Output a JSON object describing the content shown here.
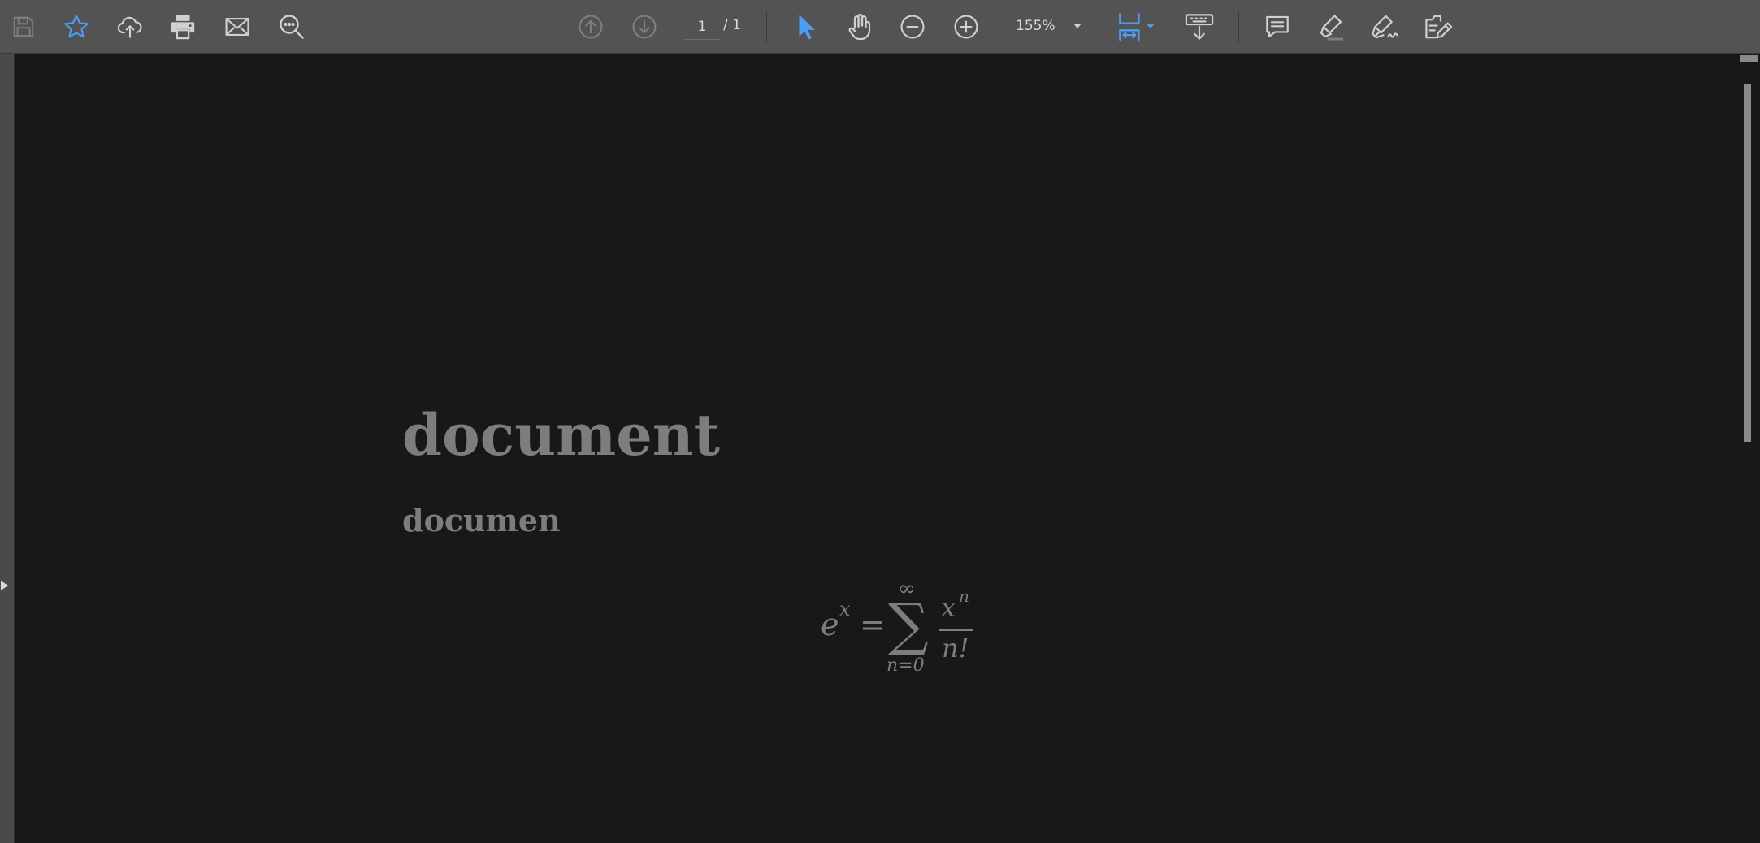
{
  "toolbar": {
    "page_current": "1",
    "page_total": "/ 1",
    "zoom": "155%",
    "icons": {
      "save": "save-icon",
      "bookmark": "star-icon",
      "upload": "cloud-upload-icon",
      "print": "printer-icon",
      "email": "envelope-icon",
      "find": "search-icon",
      "prev_page": "arrow-up-circle-icon",
      "next_page": "arrow-down-circle-icon",
      "select": "cursor-arrow-icon",
      "hand": "hand-icon",
      "zoom_out": "minus-circle-icon",
      "zoom_in": "plus-circle-icon",
      "fit_page": "fit-page-icon",
      "scroll_mode": "keyboard-scroll-icon",
      "comment": "comment-icon",
      "highlight": "highlighter-icon",
      "sign": "signature-pen-icon",
      "edit_pdf": "edit-document-icon"
    }
  },
  "document": {
    "title": "document",
    "subtitle": "documen",
    "formula": {
      "lhs_base": "e",
      "lhs_exp": "x",
      "equals": "=",
      "sum_symbol": "∑",
      "sum_upper": "∞",
      "sum_lower": "n=0",
      "numerator_base": "x",
      "numerator_exp": "n",
      "denominator": "n!"
    }
  },
  "colors": {
    "toolbar_bg": "#535353",
    "canvas_bg": "#181818",
    "icon_gray": "#d0d0d0",
    "icon_disabled": "#7e7e7e",
    "accent_blue": "#4a9ff5",
    "doc_text": "#7d7d7d"
  }
}
